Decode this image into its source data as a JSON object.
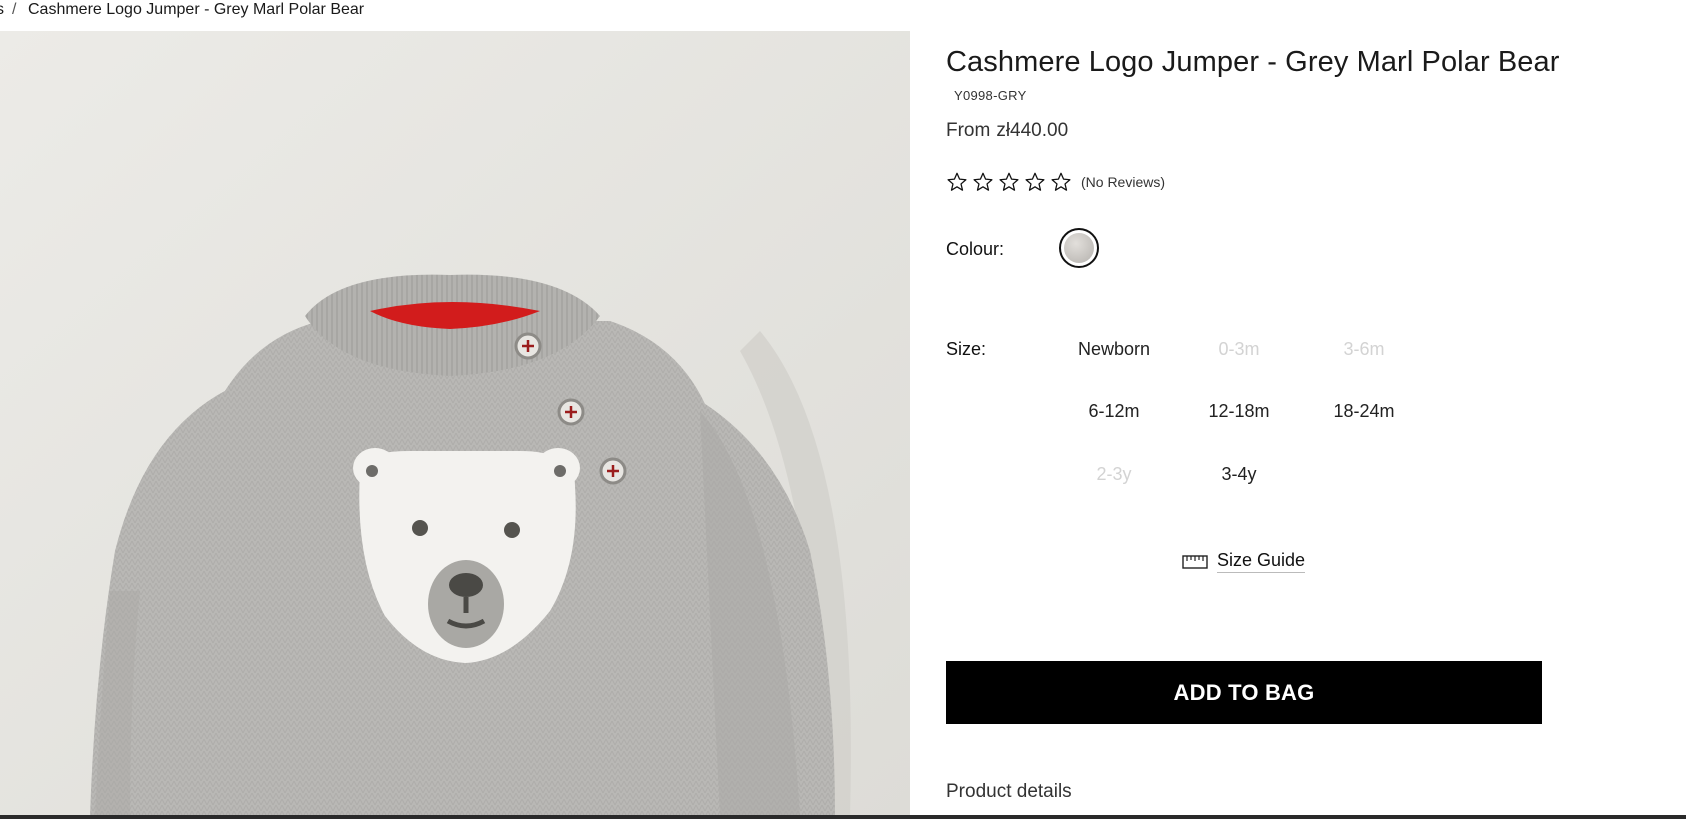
{
  "breadcrumb": {
    "previous": "s",
    "separator": "/",
    "current": "Cashmere Logo Jumper - Grey Marl Polar Bear"
  },
  "product": {
    "title": "Cashmere Logo Jumper - Grey Marl Polar Bear",
    "sku": "Y0998-GRY",
    "price_prefix": "From",
    "price": "zł440.00"
  },
  "rating": {
    "stars_filled": 0,
    "stars_total": 5,
    "review_text": "(No Reviews)"
  },
  "colour": {
    "label": "Colour:",
    "selected_swatch_color": "#c8c5c1"
  },
  "size": {
    "label": "Size:",
    "options": [
      {
        "label": "Newborn",
        "available": true
      },
      {
        "label": "0-3m",
        "available": false
      },
      {
        "label": "3-6m",
        "available": false
      },
      {
        "label": "6-12m",
        "available": true
      },
      {
        "label": "12-18m",
        "available": true
      },
      {
        "label": "18-24m",
        "available": true
      },
      {
        "label": "2-3y",
        "available": false
      },
      {
        "label": "3-4y",
        "available": true
      }
    ]
  },
  "size_guide": {
    "label": "Size Guide",
    "icon": "ruler-icon"
  },
  "actions": {
    "add_to_bag": "ADD TO BAG"
  },
  "details": {
    "label": "Product details"
  },
  "colors": {
    "button_bg": "#000000",
    "button_text": "#ffffff",
    "disabled_text": "#d3d3d3"
  }
}
